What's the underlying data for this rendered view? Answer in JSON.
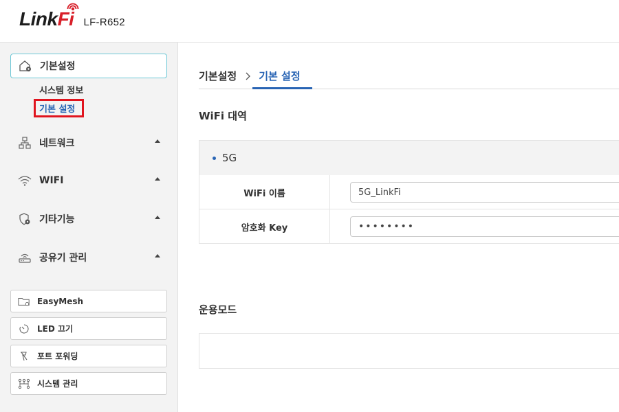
{
  "header": {
    "logo_main": "Link",
    "logo_accent": "Fi",
    "model": "LF-R652"
  },
  "sidebar": {
    "active_menu": {
      "label": "기본설정",
      "icon": "home-settings-icon"
    },
    "submenu": [
      {
        "label": "시스템 정보"
      },
      {
        "label": "기본 설정",
        "selected": true
      }
    ],
    "menus": [
      {
        "label": "네트워크",
        "icon": "network-icon"
      },
      {
        "label": "WIFI",
        "icon": "wifi-icon"
      },
      {
        "label": "기타기능",
        "icon": "shield-gear-icon"
      },
      {
        "label": "공유기 관리",
        "icon": "router-icon"
      }
    ],
    "quick_buttons": [
      {
        "label": "EasyMesh",
        "icon": "folder-gear-icon"
      },
      {
        "label": "LED 끄기",
        "icon": "timer-icon"
      },
      {
        "label": "포트 포워딩",
        "icon": "port-icon"
      },
      {
        "label": "시스템 관리",
        "icon": "nodes-icon"
      }
    ]
  },
  "breadcrumb": {
    "parent": "기본설정",
    "current": "기본 설정"
  },
  "wifi_section": {
    "title": "WiFi 대역",
    "band": "5G",
    "rows": [
      {
        "label": "WiFi 이름",
        "value": "5G_LinkFi"
      },
      {
        "label": "암호화 Key",
        "value": "••••••••"
      }
    ]
  },
  "mode_section": {
    "title": "운용모드"
  },
  "colors": {
    "accent_blue": "#2864b4",
    "logo_red": "#d8202a",
    "highlight_red": "#e0141e",
    "active_border": "#6cc7d6"
  }
}
